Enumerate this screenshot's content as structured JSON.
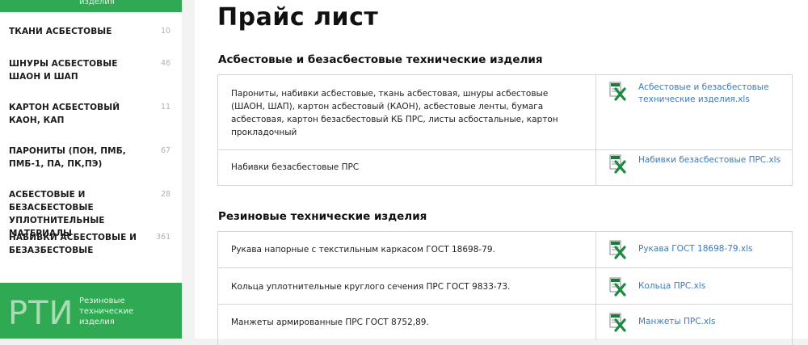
{
  "sidebar": {
    "top_banner": "изделия",
    "items": [
      {
        "label": "ТКАНИ АСБЕСТОВЫЕ",
        "count": "10"
      },
      {
        "label": "ШНУРЫ АСБЕСТОВЫЕ ШАОН И ШАП",
        "count": "46"
      },
      {
        "label": "КАРТОН АСБЕСТОВЫЙ КАОН, КАП",
        "count": "11"
      },
      {
        "label": "ПАРОНИТЫ (ПОН, ПМБ, ПМБ-1, ПА, ПК,ПЭ)",
        "count": "67"
      },
      {
        "label": "АСБЕСТОВЫЕ И БЕЗАСБЕСТОВЫЕ УПЛОТНИТЕЛЬНЫЕ МАТЕРИАЛЫ",
        "count": "28"
      },
      {
        "label": "НАБИВКИ АСБЕСТОВЫЕ И БЕЗАЗБЕСТОВЫЕ",
        "count": "361"
      }
    ],
    "promo": {
      "big_text": "РТИ",
      "small_text": "Резиновые технические изделия"
    }
  },
  "main": {
    "title": "Прайс лист",
    "sections": [
      {
        "title": "Асбестовые и безасбестовые технические изделия",
        "rows": [
          {
            "desc": "Парониты, набивки асбестовые, ткань асбестовая, шнуры асбестовые (ШАОН, ШАП), картон асбестовый (КАОН), асбестовые ленты, бумага асбестовая, картон безасбестовый КБ ПРС, листы асбостальные, картон прокладочный",
            "file": "Асбестовые и безасбестовые технические изделия.xls",
            "icon": "excel-file-icon"
          },
          {
            "desc": "Набивки безасбестовые ПРС",
            "file": "Набивки безасбестовые ПРС.xls",
            "icon": "excel-file-icon"
          }
        ]
      },
      {
        "title": "Резиновые технические изделия",
        "rows": [
          {
            "desc": "Рукава напорные с текстильным каркасом ГОСТ 18698-79.",
            "file": "Рукава ГОСТ 18698-79.xls",
            "icon": "excel-file-icon"
          },
          {
            "desc": "Кольца уплотнительные круглого сечения ПРС ГОСТ 9833-73.",
            "file": "Кольца ПРС.xls",
            "icon": "excel-file-icon"
          },
          {
            "desc": "Манжеты армированные ПРС ГОСТ 8752,89.",
            "file": "Манжеты ПРС.xls",
            "icon": "excel-file-icon"
          }
        ]
      }
    ]
  },
  "colors": {
    "brand_green": "#2faa52",
    "link_blue": "#3a7bbf",
    "excel_green": "#1d7a3c"
  }
}
